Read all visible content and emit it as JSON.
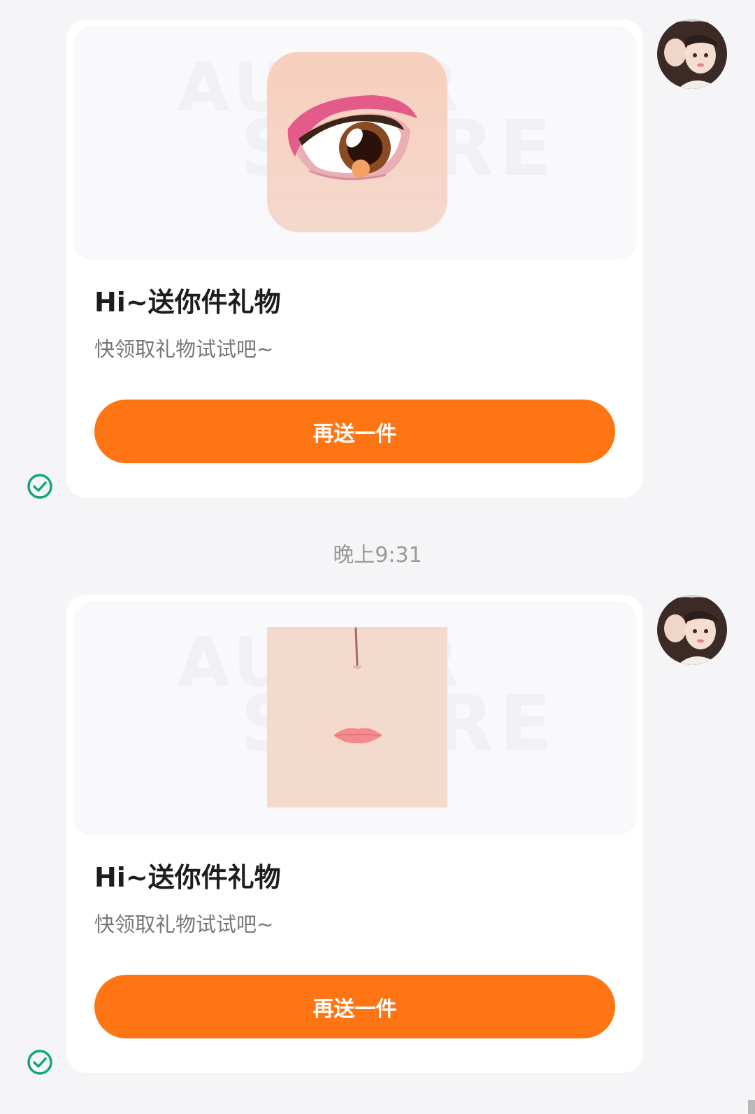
{
  "messages": [
    {
      "media": {
        "item": "eye-makeup",
        "watermark": [
          "AUTOR",
          "SCORE"
        ]
      },
      "title": "Hi~送你件礼物",
      "subtitle": "快领取礼物试试吧~",
      "button_label": "再送一件",
      "status_icon": "check-circle-icon",
      "avatar_icon": "user-avatar"
    },
    {
      "media": {
        "item": "face-nose-lips",
        "watermark": [
          "AUTOR",
          "SCORE"
        ]
      },
      "title": "Hi~送你件礼物",
      "subtitle": "快领取礼物试试吧~",
      "button_label": "再送一件",
      "status_icon": "check-circle-icon",
      "avatar_icon": "user-avatar"
    }
  ],
  "timestamp": "晚上9:31",
  "colors": {
    "accent": "#ff7413",
    "status": "#14a47c",
    "background": "#f5f5f7",
    "card": "#ffffff"
  }
}
